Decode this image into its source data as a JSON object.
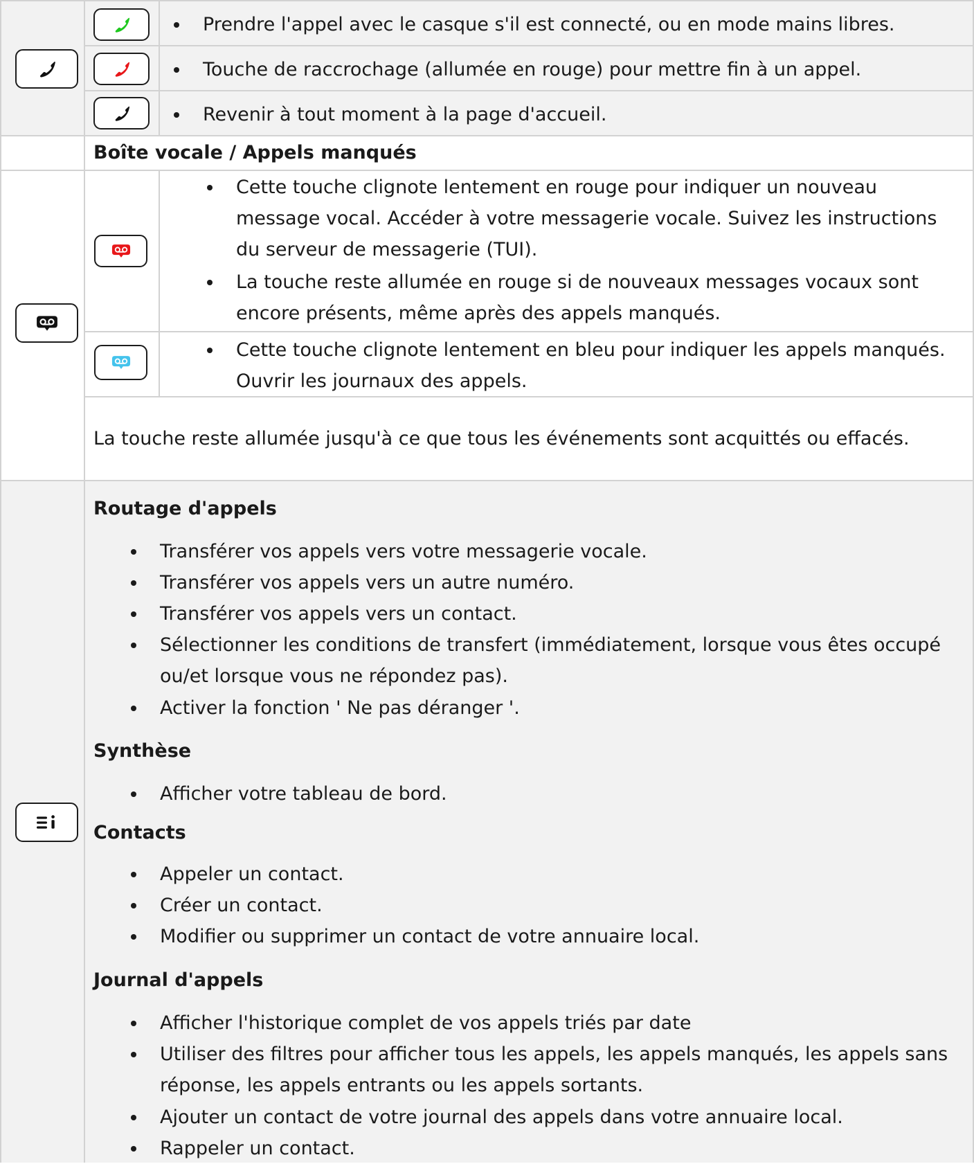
{
  "keys_section": {
    "key_icon": "phone-handset-icon",
    "rows": [
      {
        "icon": "phone-handset-icon",
        "icon_color": "#1ec81e",
        "text": "Prendre l'appel avec le casque s'il est connecté, ou en mode mains libres."
      },
      {
        "icon": "phone-handset-icon",
        "icon_color": "#e8171a",
        "text": "Touche de raccrochage (allumée en rouge) pour mettre fin à un appel."
      },
      {
        "icon": "phone-handset-icon",
        "icon_color": "#111111",
        "text": "Revenir à tout moment à la page d'accueil."
      }
    ]
  },
  "voicemail_section": {
    "heading": "Boîte vocale / Appels manqués",
    "key_icon": "voicemail-icon",
    "red_row": {
      "icon": "voicemail-icon",
      "icon_color": "#e8171a",
      "bullets": [
        "Cette touche clignote lentement en rouge pour indiquer un nouveau message vocal. Accéder à votre messagerie vocale. Suivez les instructions du serveur de messagerie (TUI).",
        "La touche reste allumée en rouge si de nouveaux messages vocaux sont encore présents, même après des appels manqués."
      ]
    },
    "blue_row": {
      "icon": "voicemail-icon",
      "icon_color": "#44c3ec",
      "bullets": [
        "Cette touche clignote lentement en bleu pour indiquer les appels manqués. Ouvrir les journaux des appels."
      ]
    },
    "note": "La touche reste allumée jusqu'à ce que tous les événements sont acquittés ou effacés."
  },
  "menu_section": {
    "key_icon": "menu-info-icon",
    "groups": [
      {
        "title": "Routage d'appels",
        "items": [
          "Transférer vos appels vers votre messagerie vocale.",
          "Transférer vos appels vers un autre numéro.",
          "Transférer vos appels vers un contact.",
          "Sélectionner les conditions de transfert (immédiatement, lorsque vous êtes occupé ou/et lorsque vous ne répondez pas).",
          "Activer la fonction ' Ne pas déranger '."
        ]
      },
      {
        "title": "Synthèse",
        "items": [
          "Afficher votre tableau de bord."
        ]
      },
      {
        "title": "Contacts",
        "items": [
          "Appeler un contact.",
          "Créer un contact.",
          "Modifier ou supprimer un contact de votre annuaire local."
        ]
      },
      {
        "title": "Journal d'appels",
        "items": [
          "Afficher l'historique complet de vos appels triés par date",
          "Utiliser des filtres pour afficher tous les appels, les appels manqués, les appels sans réponse, les appels entrants ou les appels sortants.",
          "Ajouter un contact de votre journal des appels dans votre annuaire local.",
          "Rappeler un contact."
        ]
      }
    ]
  }
}
